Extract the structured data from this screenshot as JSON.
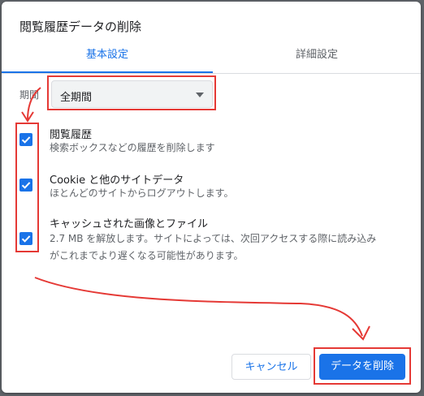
{
  "dialog": {
    "title": "閲覧履歴データの削除",
    "tabs": [
      {
        "label": "基本設定",
        "active": true
      },
      {
        "label": "詳細設定",
        "active": false
      }
    ],
    "period": {
      "label": "期間",
      "selected": "全期間"
    },
    "items": [
      {
        "title": "閲覧履歴",
        "desc": [
          "検索ボックスなどの履歴を削除します"
        ],
        "checked": true
      },
      {
        "title": "Cookie と他のサイトデータ",
        "desc": [
          "ほとんどのサイトからログアウトします。"
        ],
        "checked": true
      },
      {
        "title": "キャッシュされた画像とファイル",
        "desc": [
          "2.7 MB を解放します。サイトによっては、次回アクセスする際に読み込み",
          "がこれまでより遅くなる可能性があります。"
        ],
        "checked": true
      }
    ],
    "buttons": {
      "cancel": "キャンセル",
      "delete": "データを削除"
    }
  },
  "colors": {
    "accent": "#1a73e8",
    "annotation": "#e53935"
  },
  "icons": {
    "checkbox": "check-icon",
    "dropdown": "dropdown-arrow-icon"
  }
}
